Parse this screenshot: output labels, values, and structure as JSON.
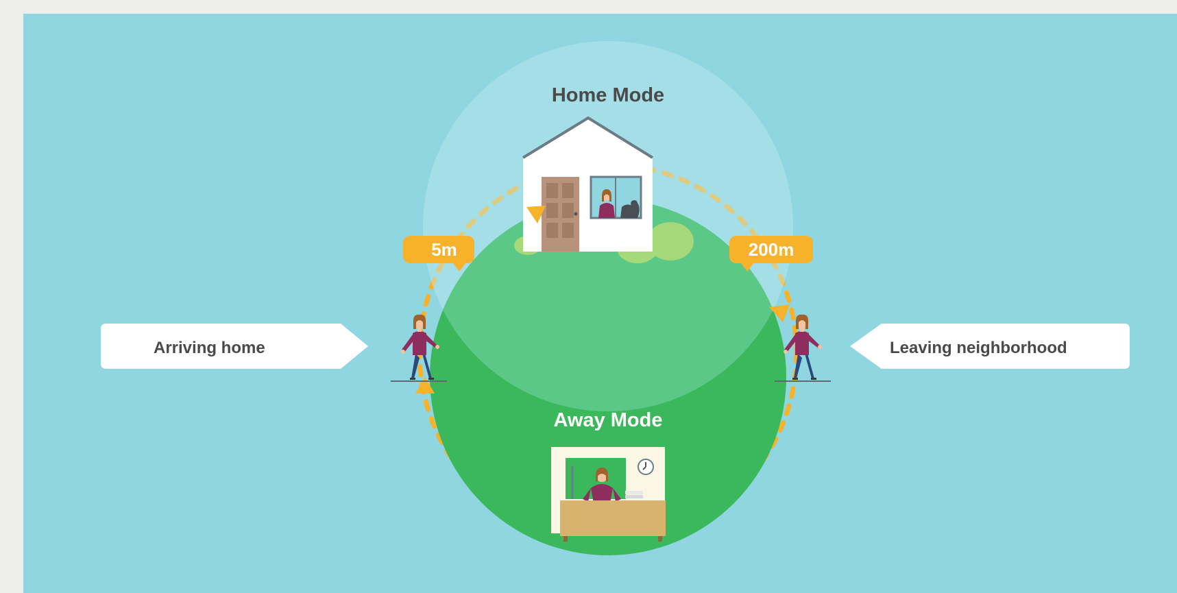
{
  "diagram": {
    "home_mode_title": "Home Mode",
    "away_mode_title": "Away Mode",
    "arriving_label": "Arriving home",
    "leaving_label": "Leaving neighborhood",
    "arrival_distance": "5m",
    "departure_distance": "200m"
  },
  "colors": {
    "page_bg": "#eeefec",
    "panel_bg": "#8fd6e1",
    "home_zone": "#a3e0e8",
    "hill_light": "#5cc888",
    "hill_dark": "#3bb85c",
    "accent_orange": "#f7b22c",
    "callout_white": "#ffffff",
    "text_dark": "#4a4a4a",
    "shirt": "#8e2e5e",
    "jeans": "#2b4a7c"
  },
  "icons": {
    "house": "house-icon",
    "office": "office-desk-icon",
    "person": "person-icon",
    "dog": "dog-icon",
    "clock": "clock-icon",
    "bushes": "bush-icon"
  }
}
